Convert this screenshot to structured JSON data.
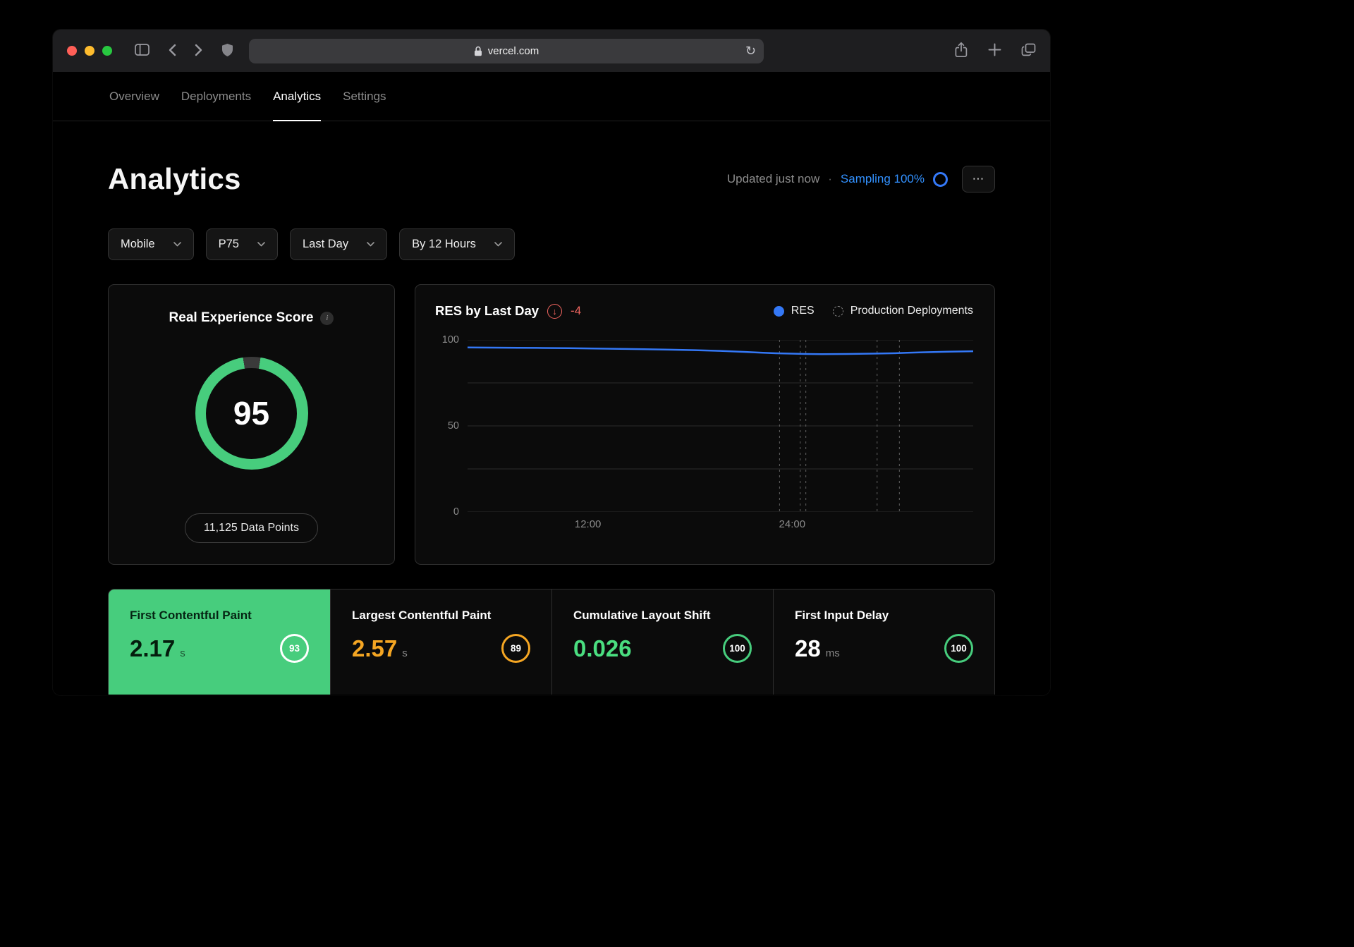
{
  "colors": {
    "accent_green": "#47cd7d",
    "green_text": "#4ade80",
    "accent_orange": "#f5a623",
    "accent_red": "#f0655f",
    "accent_blue": "#3478f6",
    "sampling_blue": "#3291ff"
  },
  "browser": {
    "url": "vercel.com",
    "reload_icon": "↻"
  },
  "nav": {
    "tabs": [
      {
        "label": "Overview"
      },
      {
        "label": "Deployments"
      },
      {
        "label": "Analytics"
      },
      {
        "label": "Settings"
      }
    ]
  },
  "header": {
    "title": "Analytics",
    "updated_text": "Updated just now",
    "separator": "·",
    "sampling_text": "Sampling 100%",
    "menu_label": "⋯"
  },
  "filters": {
    "device": "Mobile",
    "percentile": "P75",
    "range": "Last Day",
    "interval": "By 12 Hours"
  },
  "res_card": {
    "title": "Real Experience Score",
    "info_icon": "i",
    "score": "95",
    "data_points": "11,125 Data Points"
  },
  "res_chart": {
    "title": "RES by Last Day",
    "delta_icon": "↓",
    "delta": "-4",
    "legend_res": "RES",
    "legend_deployments": "Production Deployments"
  },
  "chart_data": {
    "type": "line",
    "title": "RES by Last Day",
    "ylim": [
      0,
      100
    ],
    "yticks": [
      "100",
      "50",
      "0"
    ],
    "grid_values": [
      0,
      25,
      50,
      75,
      100
    ],
    "xticks": [
      {
        "label": "12:00",
        "percent": 23.8
      },
      {
        "label": "24:00",
        "percent": 64.2
      }
    ],
    "legend": [
      "RES",
      "Production Deployments"
    ],
    "legend_position": "top-right",
    "series": [
      {
        "name": "RES",
        "x_percent": [
          0,
          5,
          10,
          15,
          20,
          25,
          30,
          35,
          40,
          45,
          50,
          55,
          58,
          61,
          64,
          67,
          70,
          75,
          80,
          84,
          87,
          90,
          95,
          100
        ],
        "values": [
          95.6,
          95.5,
          95.4,
          95.3,
          95.2,
          95.0,
          94.8,
          94.6,
          94.3,
          94.0,
          93.6,
          93.0,
          92.6,
          92.2,
          92.0,
          91.8,
          91.7,
          91.8,
          92.0,
          92.2,
          92.5,
          92.8,
          93.1,
          93.4
        ]
      }
    ],
    "deployment_lines_percent": [
      61.7,
      65.8,
      66.9,
      81.0,
      85.4
    ]
  },
  "metrics": [
    {
      "title": "First Contentful Paint",
      "value": "2.17",
      "unit": "s",
      "score": "93"
    },
    {
      "title": "Largest Contentful Paint",
      "value": "2.57",
      "unit": "s",
      "score": "89"
    },
    {
      "title": "Cumulative Layout Shift",
      "value": "0.026",
      "unit": "",
      "score": "100"
    },
    {
      "title": "First Input Delay",
      "value": "28",
      "unit": "ms",
      "score": "100"
    }
  ]
}
